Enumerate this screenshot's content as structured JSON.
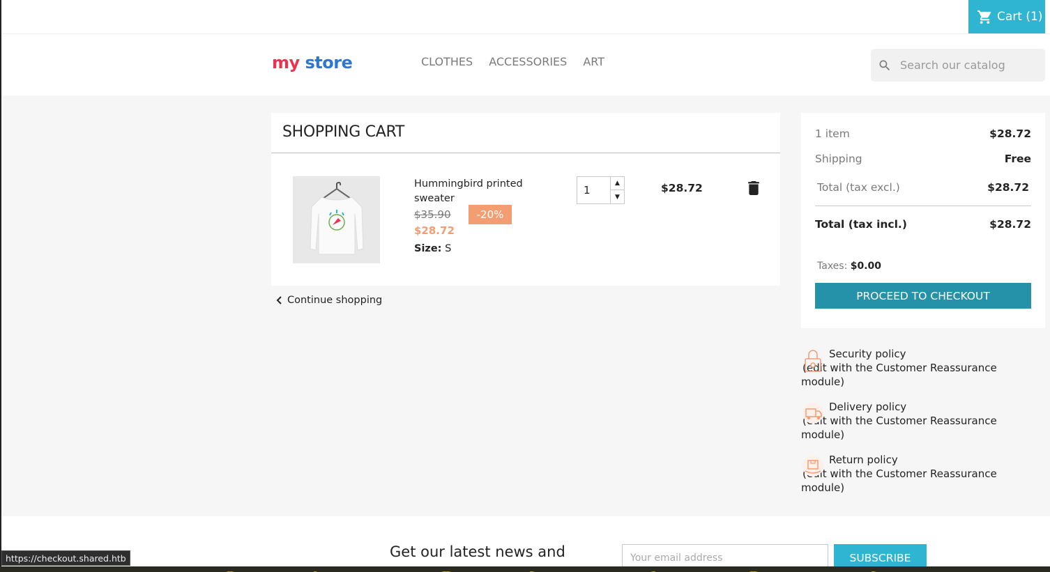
{
  "topbar": {
    "cart_label": "Cart (1)"
  },
  "header": {
    "logo": {
      "word1": "my",
      "word2": "store"
    },
    "nav": [
      "CLOTHES",
      "ACCESSORIES",
      "ART"
    ],
    "search_placeholder": "Search our catalog"
  },
  "cart": {
    "title": "SHOPPING CART",
    "item": {
      "name": "Hummingbird printed sweater",
      "old_price": "$35.90",
      "discount": "-20%",
      "price": "$28.72",
      "size_label": "Size:",
      "size_value": "S",
      "quantity": "1",
      "line_total": "$28.72"
    },
    "continue_label": "Continue shopping"
  },
  "summary": {
    "items_label": "1 item",
    "items_value": "$28.72",
    "shipping_label": "Shipping",
    "shipping_value": "Free",
    "total_excl_label": "Total (tax excl.)",
    "total_excl_value": "$28.72",
    "total_incl_label": "Total (tax incl.)",
    "total_incl_value": "$28.72",
    "taxes_label": "Taxes:",
    "taxes_value": "$0.00",
    "checkout_label": "PROCEED TO CHECKOUT"
  },
  "reassurance": [
    {
      "title": "Security policy",
      "desc": "(edit with the Customer Reassurance module)"
    },
    {
      "title": "Delivery policy",
      "desc": "(edit with the Customer Reassurance module)"
    },
    {
      "title": "Return policy",
      "desc": "(edit with the Customer Reassurance module)"
    }
  ],
  "footer": {
    "newsletter_title": "Get our latest news and",
    "email_placeholder": "Your email address",
    "subscribe_label": "SUBSCRIBE"
  },
  "status_bar": {
    "url": "https://checkout.shared.htb"
  },
  "colors": {
    "accent": "#2fb5d2",
    "checkout": "#2592a9",
    "discount": "#f39d72"
  }
}
